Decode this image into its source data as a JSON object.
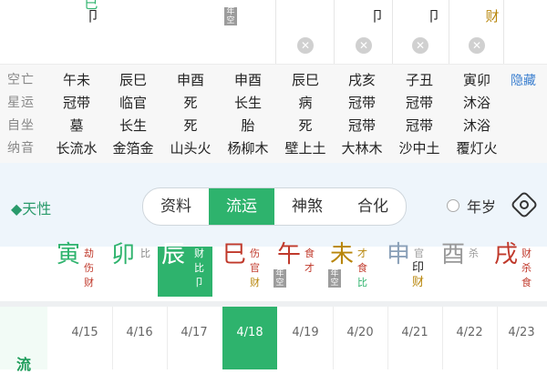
{
  "top_strip": {
    "glyphs": [
      {
        "text": "巳",
        "color": "#2eb36d"
      },
      {
        "text": "卩",
        "color": "#222222"
      },
      {
        "text": "卩",
        "color": "#222222"
      },
      {
        "text": "卩",
        "color": "#222222"
      },
      {
        "text": "财",
        "color": "#b8860b"
      }
    ],
    "badge": "年空",
    "clear_icons": 5
  },
  "info_grid": {
    "rows": [
      {
        "label": "空亡",
        "values": [
          "午未",
          "辰巳",
          "申酉",
          "申酉",
          "辰巳",
          "戌亥",
          "子丑",
          "寅卯"
        ]
      },
      {
        "label": "星运",
        "values": [
          "冠带",
          "临官",
          "死",
          "长生",
          "病",
          "冠带",
          "冠带",
          "沐浴"
        ]
      },
      {
        "label": "自坐",
        "values": [
          "墓",
          "长生",
          "死",
          "胎",
          "死",
          "冠带",
          "冠带",
          "沐浴"
        ]
      },
      {
        "label": "纳音",
        "values": [
          "长流水",
          "金箔金",
          "山头火",
          "杨柳木",
          "壁上土",
          "大林木",
          "沙中土",
          "覆灯火"
        ]
      }
    ],
    "hide_link": "隐藏"
  },
  "controls": {
    "tianxing": "◆天性",
    "tabs": [
      "资料",
      "流运",
      "神煞",
      "合化"
    ],
    "active_tab": 1,
    "year_label": "年岁"
  },
  "pillars": [
    {
      "big": "寅",
      "big_color": "#2eb36d",
      "smalls": [
        "劫",
        "伤",
        "财"
      ],
      "small_color": "#c0392b",
      "tag": ""
    },
    {
      "big": "卯",
      "big_color": "#2eb36d",
      "smalls": [
        "比",
        "",
        ""
      ],
      "small_color": "#888888",
      "tag": ""
    },
    {
      "big": "辰",
      "big_color": "#ffffff",
      "smalls": [
        "财",
        "比",
        "卩"
      ],
      "small_color": "#ffffff",
      "tag": "",
      "highlight": true
    },
    {
      "big": "巳",
      "big_color": "#c0392b",
      "smalls": [
        "伤",
        "官",
        "财"
      ],
      "small_color": "#c0392b",
      "tag": ""
    },
    {
      "big": "午",
      "big_color": "#c0392b",
      "smalls": [
        "食",
        "才",
        ""
      ],
      "small_color": "#c0392b",
      "tag": "年空"
    },
    {
      "big": "未",
      "big_color": "#b8860b",
      "smalls": [
        "才",
        "食",
        "比"
      ],
      "small_color": "#b8860b",
      "tag": "年空"
    },
    {
      "big": "申",
      "big_color": "#8aa0b8",
      "smalls": [
        "官",
        "印",
        "财"
      ],
      "small_color": "#555555",
      "tag": ""
    },
    {
      "big": "酉",
      "big_color": "#999999",
      "smalls": [
        "杀",
        "",
        ""
      ],
      "small_color": "#999999",
      "tag": ""
    },
    {
      "big": "戌",
      "big_color": "#c0392b",
      "smalls": [
        "财",
        "杀",
        "食"
      ],
      "small_color": "#c0392b",
      "tag": ""
    }
  ],
  "dates": {
    "row_label": "流",
    "values": [
      "4/15",
      "4/16",
      "4/17",
      "4/18",
      "4/19",
      "4/20",
      "4/21",
      "4/22",
      "4/23"
    ],
    "active_index": 3
  },
  "colors": {
    "accent": "#2eb36d",
    "link": "#3b7fcf"
  }
}
